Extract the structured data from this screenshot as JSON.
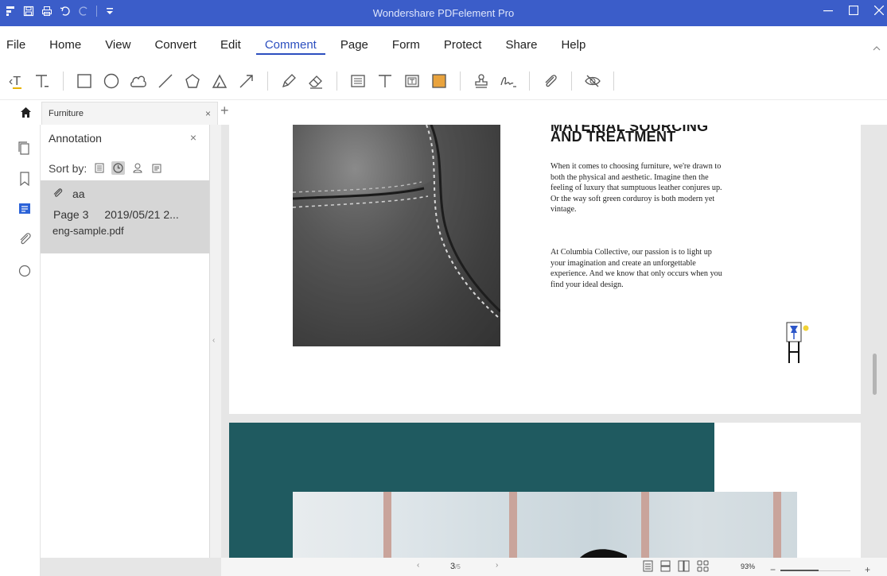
{
  "colors": {
    "titlebar": "#3b5dc9",
    "accent": "#2c4fbf",
    "teal": "#1f5a60",
    "selected_row": "#d6d6d6"
  },
  "window": {
    "title": "Wondershare PDFelement Pro"
  },
  "quick_access": [
    "app-icon",
    "save-icon",
    "print-icon",
    "undo-icon",
    "redo-icon",
    "customize-dropdown-icon"
  ],
  "menu": {
    "items": [
      "File",
      "Home",
      "View",
      "Convert",
      "Edit",
      "Comment",
      "Page",
      "Form",
      "Protect",
      "Share",
      "Help"
    ],
    "active": "Comment"
  },
  "toolbar": {
    "groups": [
      [
        "underline-text-icon",
        "strikethrough-text-icon"
      ],
      [
        "rectangle-icon",
        "oval-icon",
        "cloud-icon",
        "line-icon",
        "polygon-icon",
        "connected-lines-icon",
        "arrow-icon"
      ],
      [
        "pencil-icon",
        "eraser-icon"
      ],
      [
        "sticky-note-icon",
        "text-comment-icon",
        "text-box-icon",
        "area-highlight-icon"
      ],
      [
        "stamp-icon",
        "signature-icon"
      ],
      [
        "attachment-icon"
      ],
      [
        "hide-comments-icon"
      ]
    ]
  },
  "tabs": [
    {
      "label": "Furniture",
      "close": "×"
    }
  ],
  "new_tab": "+",
  "panel": {
    "title": "Annotation",
    "close": "×",
    "sort_label": "Sort by:",
    "annotations": [
      {
        "icon": "paperclip-icon",
        "name": "aa",
        "page": "Page 3",
        "date": "2019/05/21 2...",
        "author": "eng-sample.pdf"
      }
    ]
  },
  "document": {
    "heading_partial": "MATERIAL SOURCING",
    "heading": "AND TREATMENT",
    "paragraph1": "When it comes to choosing furniture, we're drawn to both the physical and aesthetic. Imagine then the feeling of luxury that sumptuous leather conjures up. Or the way soft green corduroy is both modern yet vintage.",
    "paragraph2": "At Columbia Collective, our passion is to light up your imagination and create an unforgettable experience. And we know that only occurs when you find your ideal design."
  },
  "status": {
    "current_page": "3",
    "total_pages": "/5",
    "zoom": "93%",
    "zoom_minus": "−",
    "zoom_plus": "+",
    "zoom_level": 0.55
  }
}
